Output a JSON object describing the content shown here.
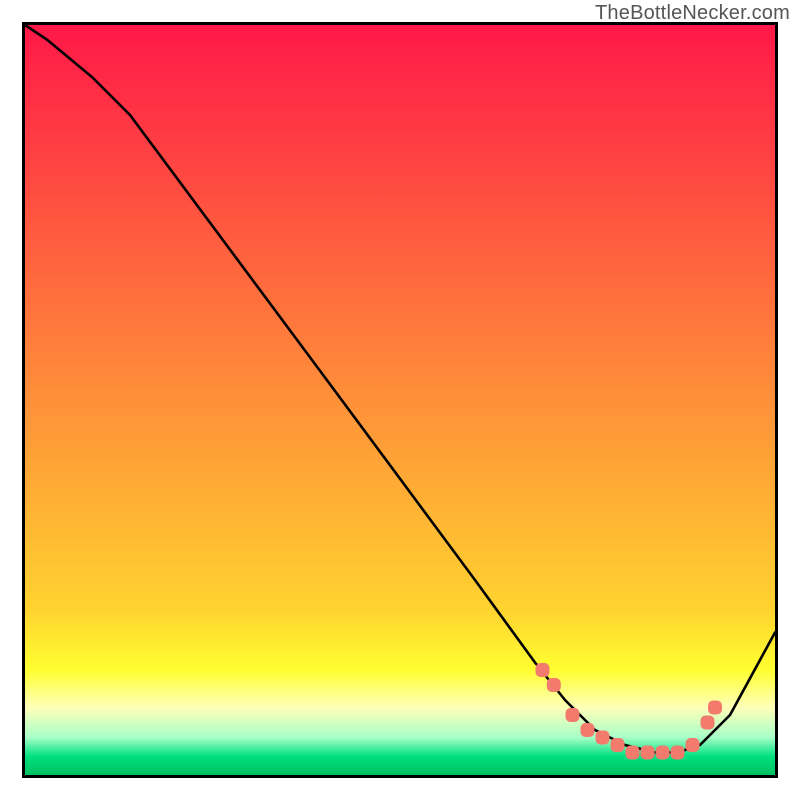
{
  "watermark": "TheBottleNecker.com",
  "chart_data": {
    "type": "line",
    "title": "",
    "xlabel": "",
    "ylabel": "",
    "xlim": [
      0,
      100
    ],
    "ylim": [
      0,
      100
    ],
    "gradient_bands": [
      {
        "y_top": 100,
        "y_bottom": 22,
        "color_top": "#ff1848",
        "color_bottom": "#ffd330"
      },
      {
        "y_top": 22,
        "y_bottom": 14,
        "color_top": "#ffd330",
        "color_bottom": "#ffff30"
      },
      {
        "y_top": 14,
        "y_bottom": 9,
        "color_top": "#ffff30",
        "color_bottom": "#feffb8"
      },
      {
        "y_top": 9,
        "y_bottom": 5,
        "color_top": "#feffb8",
        "color_bottom": "#a8ffc8"
      },
      {
        "y_top": 5,
        "y_bottom": 2.5,
        "color_top": "#a8ffc8",
        "color_bottom": "#00e080"
      },
      {
        "y_top": 2.5,
        "y_bottom": 0,
        "color_top": "#00e080",
        "color_bottom": "#00c060"
      }
    ],
    "series": [
      {
        "name": "curve",
        "x": [
          0,
          3,
          9,
          14,
          40,
          60,
          68,
          72,
          76,
          80,
          84,
          87,
          90,
          94,
          100
        ],
        "y": [
          100,
          98,
          93,
          88,
          53,
          26,
          15,
          10,
          6,
          4,
          3,
          3,
          4,
          8,
          19
        ]
      }
    ],
    "markers": {
      "name": "dots",
      "shape": "rounded-rect",
      "color": "#f37b6d",
      "points": [
        {
          "x": 69,
          "y": 14
        },
        {
          "x": 70.5,
          "y": 12
        },
        {
          "x": 73,
          "y": 8
        },
        {
          "x": 75,
          "y": 6
        },
        {
          "x": 77,
          "y": 5
        },
        {
          "x": 79,
          "y": 4
        },
        {
          "x": 81,
          "y": 3
        },
        {
          "x": 83,
          "y": 3
        },
        {
          "x": 85,
          "y": 3
        },
        {
          "x": 87,
          "y": 3
        },
        {
          "x": 89,
          "y": 4
        },
        {
          "x": 91,
          "y": 7
        },
        {
          "x": 92,
          "y": 9
        }
      ]
    }
  }
}
